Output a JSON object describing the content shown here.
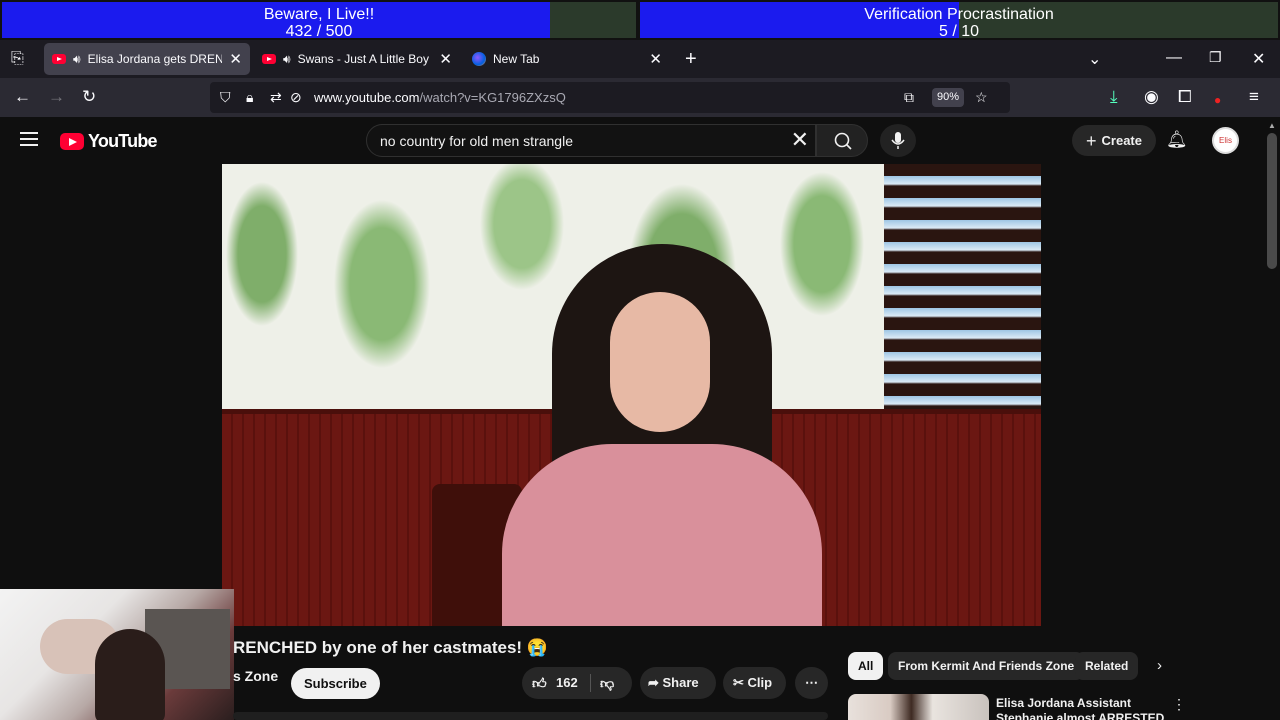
{
  "overlay": {
    "goal1": {
      "title": "Beware, I Live!!",
      "progress": "432 / 500",
      "fraction": 0.864
    },
    "goal2": {
      "title": "Verification Procrastination",
      "progress": "5 / 10",
      "fraction": 0.5
    }
  },
  "browser": {
    "tabs": [
      {
        "title": "Elisa Jordana gets DRENCH",
        "active": true
      },
      {
        "title": "Swans - Just A Little Boy (F",
        "active": false
      },
      {
        "title": "New Tab",
        "active": false
      }
    ],
    "url_host": "www.youtube.com",
    "url_rest": "/watch?v=KG1796ZXzsQ",
    "zoom": "90%"
  },
  "youtube": {
    "logo_text": "YouTube",
    "search_value": "no country for old men strangle",
    "create_label": "Create",
    "avatar_text": "Elis"
  },
  "video": {
    "title": "RENCHED by one of her castmates! 😭",
    "channel": "s Zone",
    "subscribe_label": "Subscribe",
    "likes": "162",
    "share_label": "Share",
    "clip_label": "Clip"
  },
  "recommendations": {
    "chips": [
      "All",
      "From Kermit And Friends Zone",
      "Related"
    ],
    "first_item_title": "Elisa Jordana Assistant Stephanie almost ARRESTED"
  },
  "colors": {
    "overlay_fill": "#1b1bee",
    "yt_red": "#ff0033",
    "page_bg": "#0f0f0f"
  }
}
